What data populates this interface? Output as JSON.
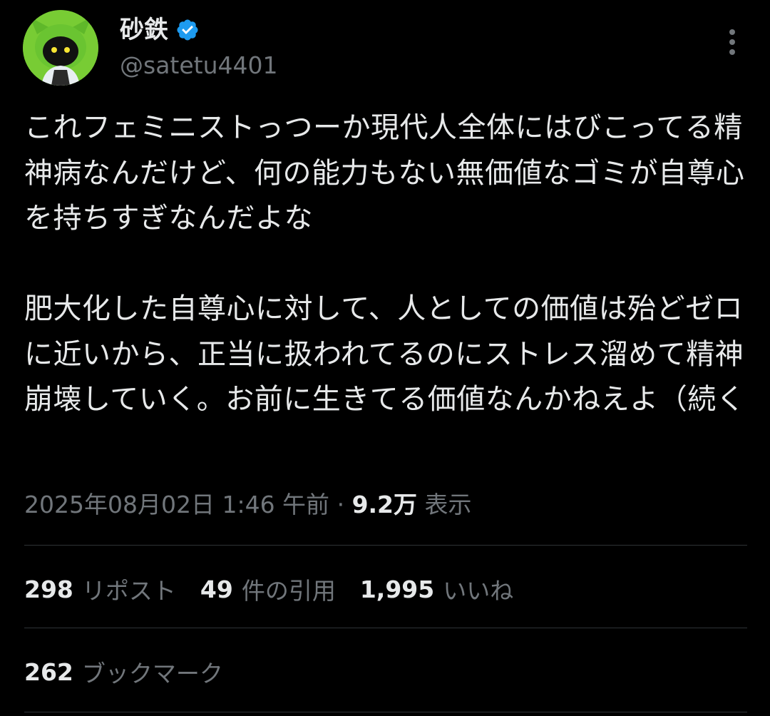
{
  "theme": {
    "background": "#000000",
    "primary_text": "#e7e9ea",
    "secondary_text": "#71767b",
    "divider": "#2f3336",
    "verified_badge": "#1d9bf0",
    "avatar_bg": "#7fd33a"
  },
  "author": {
    "display_name": "砂鉄",
    "handle": "@satetu4401",
    "verified": true,
    "avatar_icon": "avatar-image",
    "verified_icon": "verified-badge-icon"
  },
  "header": {
    "more_icon": "more-vertical-icon"
  },
  "tweet": {
    "paragraphs": [
      "これフェミニストっつーか現代人全体にはびこってる精神病なんだけど、何の能力もない無価値なゴミが自尊心を持ちすぎなんだよな",
      "肥大化した自尊心に対して、人としての価値は殆どゼロに近いから、正当に扱われてるのにストレス溜めて精神崩壊していく。お前に生きてる価値なんかねえよ（続く"
    ],
    "timestamp": "2025年08月02日 1:46 午前",
    "separator": "·",
    "views_count": "9.2万",
    "views_label": "表示"
  },
  "stats": {
    "reposts": {
      "count": "298",
      "label": "リポスト"
    },
    "quotes": {
      "count": "49",
      "label": "件の引用"
    },
    "likes": {
      "count": "1,995",
      "label": "いいね"
    },
    "bookmarks": {
      "count": "262",
      "label": "ブックマーク"
    }
  }
}
